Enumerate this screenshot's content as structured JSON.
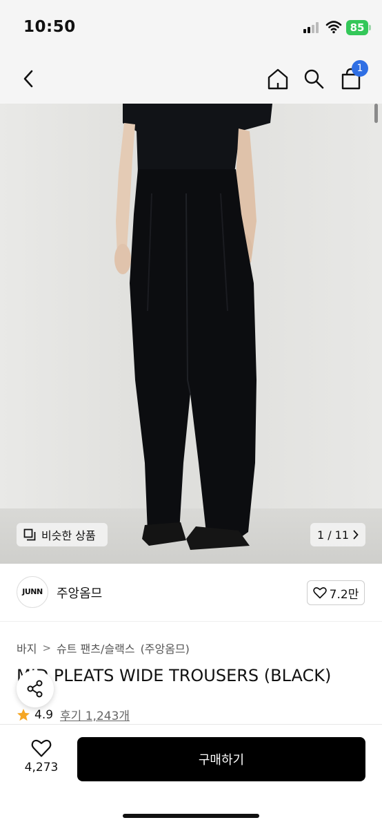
{
  "status_bar": {
    "time": "10:50",
    "battery": "85"
  },
  "nav": {
    "cart_count": "1"
  },
  "gallery": {
    "similar_label": "비슷한 상품",
    "pager": "1 / 11"
  },
  "brand": {
    "logo_text": "JUNN",
    "name": "주앙옴므",
    "likes": "7.2만"
  },
  "breadcrumb": [
    "바지",
    "슈트 팬츠/슬랙스",
    "(주앙옴므)"
  ],
  "product": {
    "title": "MID PLEATS WIDE TROUSERS (BLACK)",
    "rating": "4.9",
    "reviews": "후기 1,243개"
  },
  "bottom": {
    "wish_count": "4,273",
    "buy_label": "구매하기"
  },
  "colors": {
    "accent_badge": "#2f6fe4",
    "battery": "#34c759",
    "star": "#f5a623",
    "buy_button": "#000000"
  }
}
